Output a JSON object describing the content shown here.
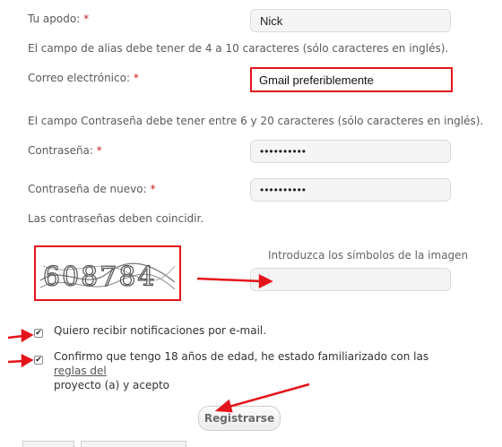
{
  "nickname": {
    "label": "Tu apodo:",
    "required_mark": "*",
    "value": "Nick",
    "hint": "El campo de alias debe tener de 4 a 10 caracteres (sólo caracteres en inglés)."
  },
  "email": {
    "label": "Correo electrónico:",
    "required_mark": "*",
    "value": "Gmail preferiblemente"
  },
  "password": {
    "hint": "El campo Contraseña debe tener entre 6 y 20 caracteres (sólo caracteres en inglés).",
    "label": "Contraseña:",
    "required_mark": "*",
    "value": "••••••••••"
  },
  "password_repeat": {
    "label": "Contraseña de nuevo:",
    "required_mark": "*",
    "value": "••••••••••",
    "hint": "Las contraseñas deben coincidir."
  },
  "captcha": {
    "label": "Introduzca los símbolos de la imagen",
    "value": "",
    "image_text": "608784"
  },
  "notifications": {
    "checked": true,
    "label": "Quiero recibir notificaciones por e-mail."
  },
  "confirm": {
    "checked": true,
    "text": "Confirmo que tengo 18 años de edad, he estado familiarizado con las ",
    "link": "reglas del",
    "text2": "proyecto (a) y acepto"
  },
  "submit": {
    "label": "Registrarse"
  },
  "colors": {
    "annotation_red": "#e4141b",
    "required": "#cc2222"
  }
}
